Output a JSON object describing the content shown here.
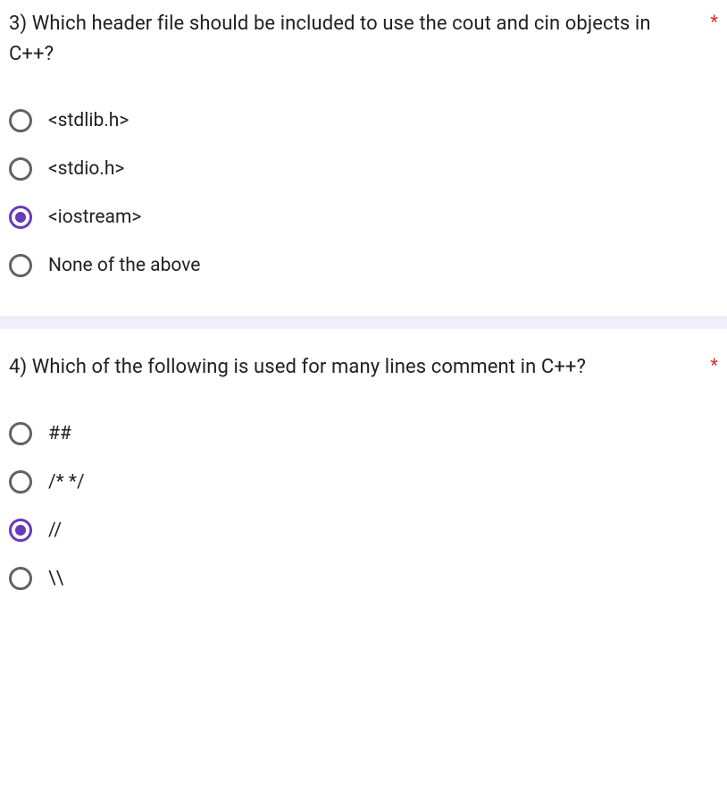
{
  "required_mark": "*",
  "questions": [
    {
      "number": "3)",
      "text": "Which header file should be included to use the cout and cin objects in C++?",
      "options": [
        {
          "label": "<stdlib.h>",
          "selected": false
        },
        {
          "label": "<stdio.h>",
          "selected": false
        },
        {
          "label": "<iostream>",
          "selected": true
        },
        {
          "label": "None of the above",
          "selected": false
        }
      ]
    },
    {
      "number": "4)",
      "text": "Which of the following is used for many lines comment in C++?",
      "options": [
        {
          "label": "##",
          "selected": false
        },
        {
          "label": "/* */",
          "selected": false
        },
        {
          "label": "//",
          "selected": true
        },
        {
          "label": "\\\\",
          "selected": false
        }
      ]
    }
  ]
}
